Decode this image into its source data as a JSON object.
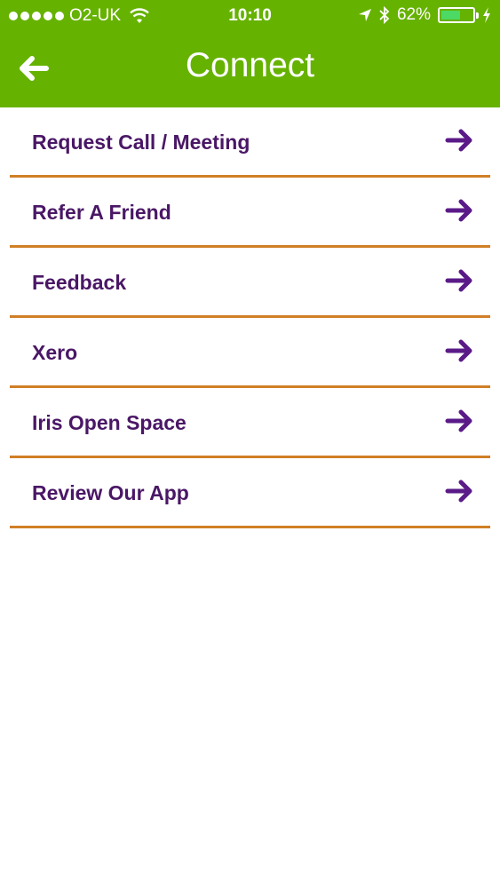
{
  "status_bar": {
    "signal_bars": 5,
    "carrier": "O2-UK",
    "time": "10:10",
    "battery_percent": "62%",
    "battery_level": 0.62
  },
  "nav": {
    "back_icon": "arrow-left-icon",
    "title": "Connect"
  },
  "menu": {
    "items": [
      {
        "label": "Request Call / Meeting"
      },
      {
        "label": "Refer A Friend"
      },
      {
        "label": "Feedback"
      },
      {
        "label": "Xero"
      },
      {
        "label": "Iris Open Space"
      },
      {
        "label": "Review Our App"
      }
    ],
    "arrow_icon": "arrow-right-icon"
  },
  "colors": {
    "header": "#66b200",
    "item_text": "#4a1766",
    "arrow": "#5a1a87",
    "divider": "#d07f26",
    "battery": "#4cd964"
  }
}
